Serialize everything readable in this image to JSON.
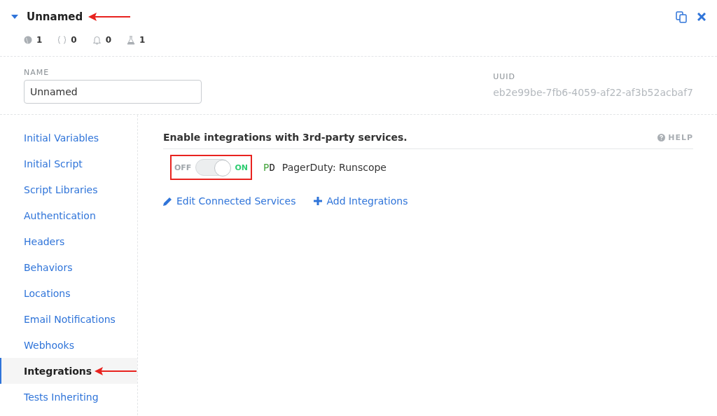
{
  "header": {
    "title": "Unnamed",
    "expanded": true,
    "stats": [
      {
        "kind": "globe",
        "count": "1"
      },
      {
        "kind": "braces",
        "count": "0"
      },
      {
        "kind": "bell",
        "count": "0"
      },
      {
        "kind": "flask",
        "count": "1"
      }
    ]
  },
  "name_field": {
    "label": "NAME",
    "value": "Unnamed"
  },
  "uuid": {
    "label": "UUID",
    "value": "eb2e99be-7fb6-4059-af22-af3b52acbaf7"
  },
  "sidebar": {
    "items": [
      {
        "label": "Initial Variables",
        "selected": false
      },
      {
        "label": "Initial Script",
        "selected": false
      },
      {
        "label": "Script Libraries",
        "selected": false
      },
      {
        "label": "Authentication",
        "selected": false
      },
      {
        "label": "Headers",
        "selected": false
      },
      {
        "label": "Behaviors",
        "selected": false
      },
      {
        "label": "Locations",
        "selected": false
      },
      {
        "label": "Email Notifications",
        "selected": false
      },
      {
        "label": "Webhooks",
        "selected": false
      },
      {
        "label": "Integrations",
        "selected": true
      },
      {
        "label": "Tests Inheriting",
        "selected": false
      }
    ]
  },
  "content": {
    "heading": "Enable integrations with 3rd-party services.",
    "help": "HELP",
    "integrations": [
      {
        "off_label": "OFF",
        "on_label": "ON",
        "on": true,
        "logo": "PD",
        "name": "PagerDuty: Runscope"
      }
    ],
    "links": [
      {
        "kind": "edit",
        "label": "Edit Connected Services"
      },
      {
        "kind": "add",
        "label": "Add Integrations"
      }
    ]
  }
}
